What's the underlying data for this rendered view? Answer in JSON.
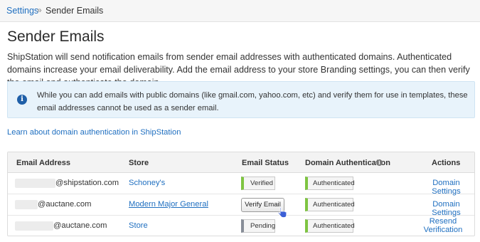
{
  "breadcrumb": {
    "parent": "Settings",
    "separator": "»",
    "current": "Sender Emails"
  },
  "page": {
    "title": "Sender Emails",
    "intro": "ShipStation will send notification emails from sender email addresses with authenticated domains. Authenticated domains increase your email deliverability. Add the email address to your store Branding settings, you can then verify the email and authenticate the domain."
  },
  "info_box": {
    "icon": "info-icon",
    "text": "While you can add emails with public domains (like gmail.com, yahoo.com, etc) and verify them for use in templates, these email addresses cannot be used as a sender email."
  },
  "learn_link": "Learn about domain authentication in ShipStation",
  "table": {
    "headers": {
      "email": "Email Address",
      "store": "Store",
      "status": "Email Status",
      "domain": "Domain Authentication",
      "actions": "Actions"
    },
    "rows": [
      {
        "email_visible": "@shipstation.com",
        "store": "Schoney's",
        "status": "Verified",
        "domain": "Authenticated",
        "action": "Domain Settings"
      },
      {
        "email_visible": "@auctane.com",
        "store": "Modern Major General",
        "status": "Verify Email",
        "domain": "Authenticated",
        "action": "Domain Settings"
      },
      {
        "email_visible": "@auctane.com",
        "store": "Store",
        "status": "Pending",
        "domain": "Authenticated",
        "action": "Resend Verification"
      }
    ]
  },
  "colors": {
    "link": "#1f6fc0",
    "success": "#7ec441",
    "pending": "#888e98",
    "info_bg": "#e8f3fb"
  }
}
